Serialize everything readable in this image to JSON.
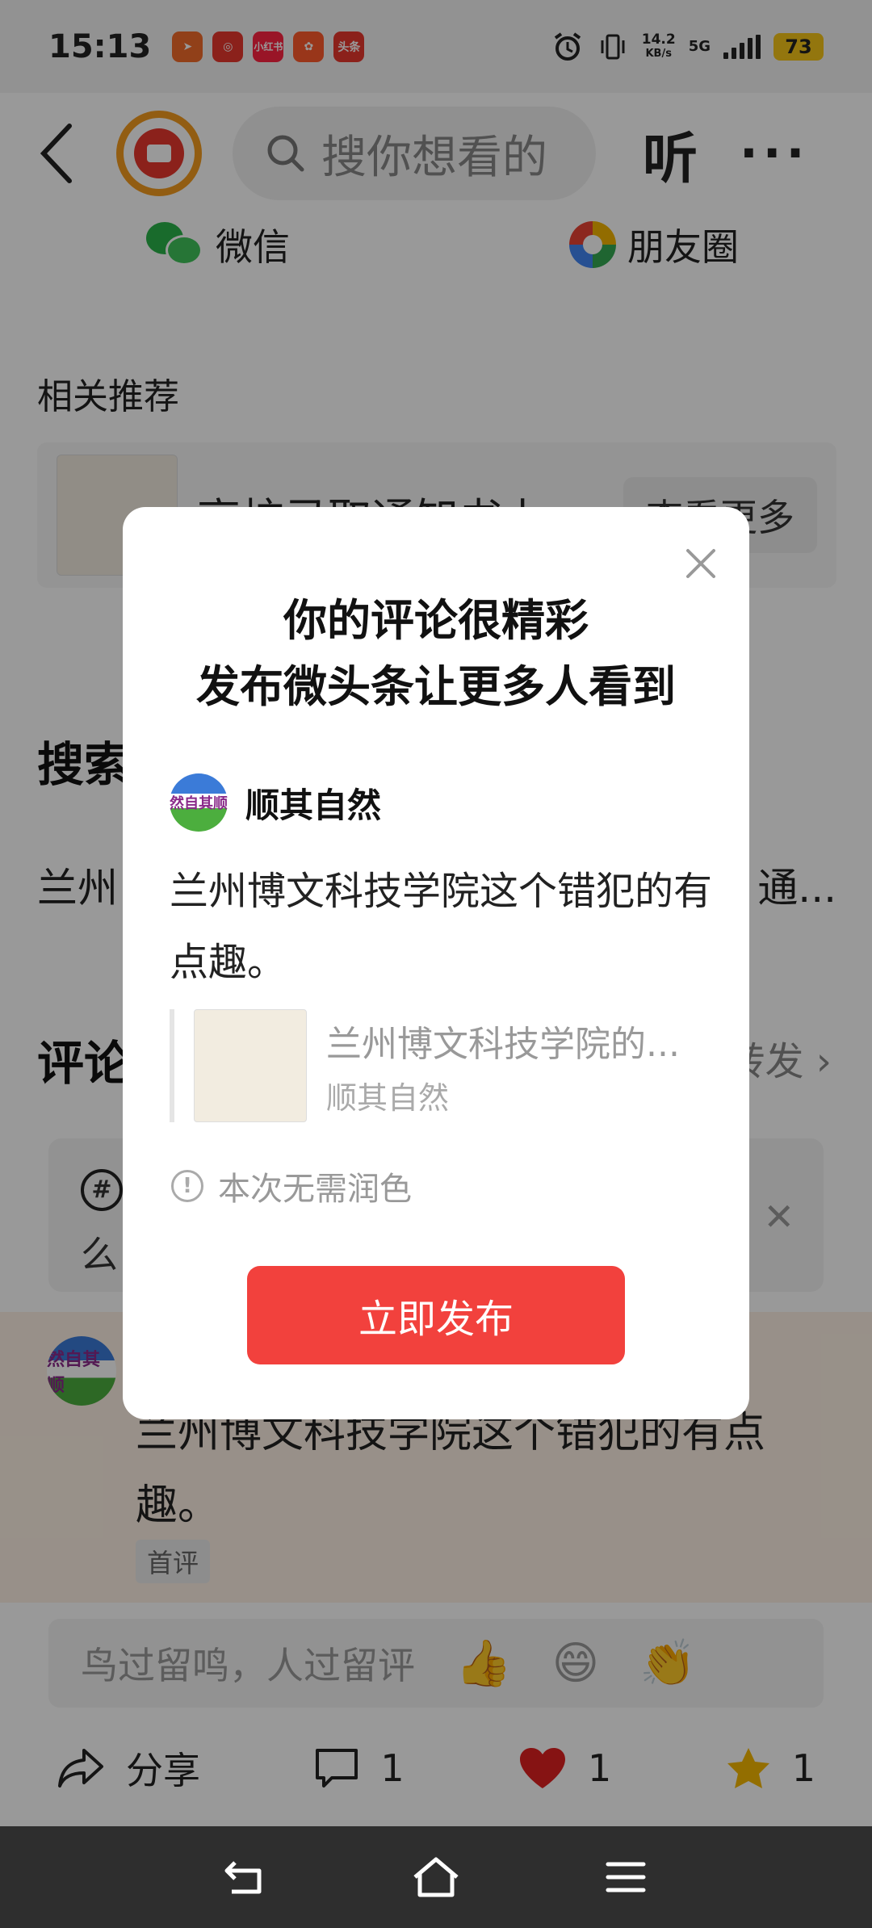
{
  "status_bar": {
    "time": "15:13",
    "app_badges": [
      {
        "label": "",
        "color": "#f26b2a"
      },
      {
        "label": "",
        "color": "#e8372d"
      },
      {
        "label": "小红书",
        "color": "#ff2442"
      },
      {
        "label": "",
        "color": "#ff5b2c"
      },
      {
        "label": "头条",
        "color": "#e8372d"
      }
    ],
    "net_speed_value": "14.2",
    "net_speed_unit": "KB/s",
    "net_type": "5G",
    "battery": "73"
  },
  "header": {
    "search_placeholder": "搜你想看的",
    "listen_label": "听"
  },
  "share": {
    "wechat_label": "微信",
    "moments_label": "朋友圈"
  },
  "related": {
    "heading": "相关推荐",
    "card_title": "高校录取通知书上",
    "more_label": "查看更多"
  },
  "search_section": {
    "heading": "搜索",
    "left_text": "兰州",
    "right_text": "通..."
  },
  "comments_section": {
    "heading": "评论",
    "repost_label": "转发"
  },
  "comment_tip": {
    "line2": "么"
  },
  "my_comment": {
    "text": "兰州博文科技学院这个错犯的有点趣。",
    "badge": "首评",
    "avatar_text": "然自其顺"
  },
  "comment_input": {
    "placeholder": "鸟过留鸣，人过留评",
    "emojis": [
      "👍",
      "😄",
      "👏"
    ]
  },
  "actions": {
    "share_label": "分享",
    "comment_count": "1",
    "like_count": "1",
    "favorite_count": "1"
  },
  "modal": {
    "title_line1": "你的评论很精彩",
    "title_line2": "发布微头条让更多人看到",
    "username": "顺其自然",
    "avatar_text": "然自其顺",
    "comment_text": "兰州博文科技学院这个错犯的有点趣。",
    "quote_title": "兰州博文科技学院的...",
    "quote_author": "顺其自然",
    "polish_note": "本次无需润色",
    "publish_label": "立即发布"
  },
  "colors": {
    "accent_red": "#f2413d",
    "like_red": "#e02020",
    "star_gold": "#f5b800",
    "battery_yellow": "#f5c518"
  }
}
